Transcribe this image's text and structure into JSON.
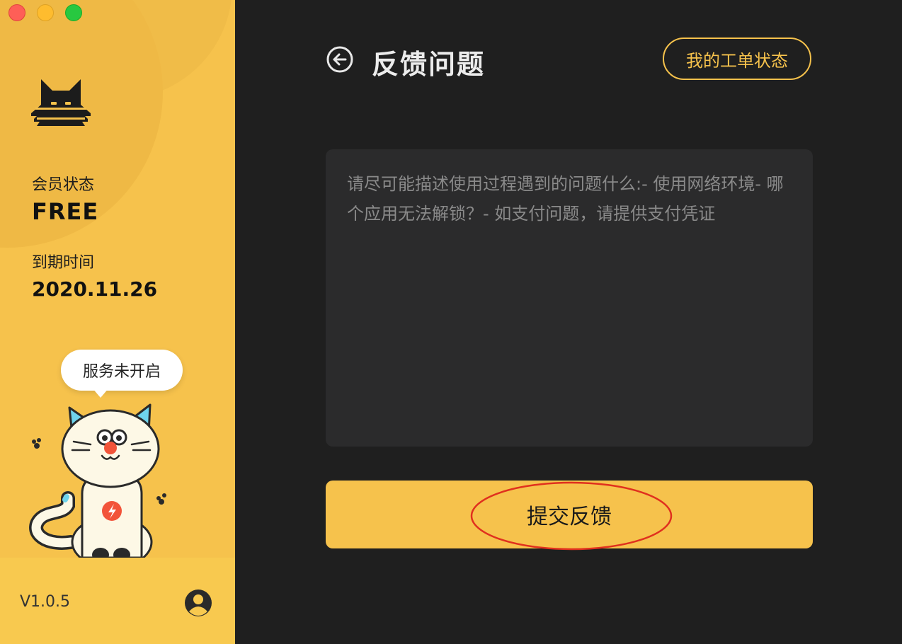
{
  "window": {
    "controls": [
      "close",
      "minimize",
      "zoom"
    ]
  },
  "sidebar": {
    "logo_icon": "cat-logo-icon",
    "member_status_label": "会员状态",
    "member_status_value": "FREE",
    "expire_label": "到期时间",
    "expire_value": "2020.11.26",
    "service_bubble": "服务未开启",
    "mascot_icon": "cat-mascot-icon",
    "version": "V1.0.5",
    "user_icon": "user-avatar-icon"
  },
  "main": {
    "back_icon": "back-arrow-icon",
    "title": "反馈问题",
    "ticket_status_button": "我的工单状态",
    "feedback_placeholder": "请尽可能描述使用过程遇到的问题什么:- 使用网络环境- 哪个应用无法解锁？- 如支付问题，请提供支付凭证",
    "submit_button": "提交反馈"
  },
  "colors": {
    "accent": "#f6c24c",
    "background_dark": "#1f1f1f",
    "input_background": "#2b2b2c",
    "annotation": "#e0301e"
  }
}
